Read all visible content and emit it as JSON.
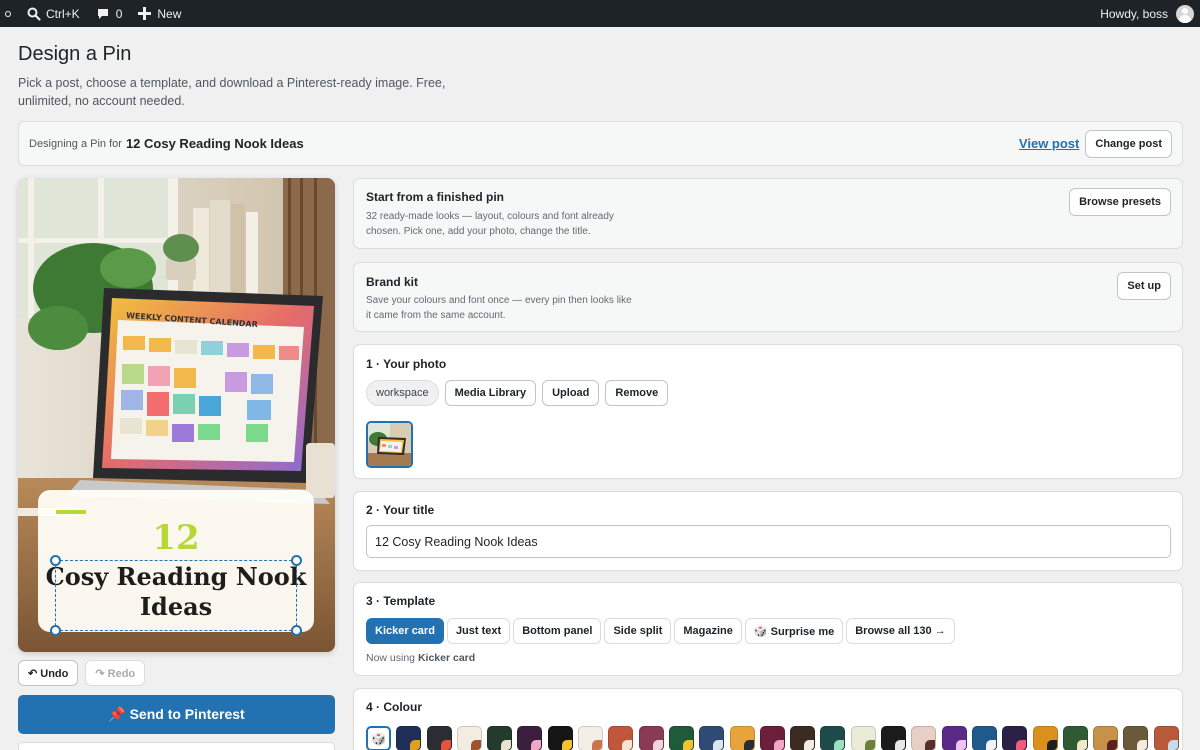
{
  "admin_bar": {
    "search_label": "Ctrl+K",
    "comments_count": "0",
    "new_label": "New",
    "greeting": "Howdy, boss"
  },
  "header": {
    "title": "Design a Pin",
    "description": "Pick a post, choose a template, and download a Pinterest-ready image. Free, unlimited, no account needed."
  },
  "context": {
    "prefix": "Designing a Pin for",
    "post_title": "12 Cosy Reading Nook Ideas",
    "view_post": "View post",
    "change_post": "Change post"
  },
  "preview": {
    "number": "12",
    "title": "Cosy Reading Nook Ideas",
    "photo_screen_text": "WEEKLY CONTENT CALENDAR",
    "undo_label": "↶ Undo",
    "redo_label": "↷ Redo",
    "send_label": "📌 Send to Pinterest"
  },
  "presets": {
    "title": "Start from a finished pin",
    "description": "32 ready-made looks — layout, colours and font already chosen. Pick one, add your photo, change the title.",
    "button": "Browse presets"
  },
  "brand_kit": {
    "title": "Brand kit",
    "description": "Save your colours and font once — every pin then looks like it came from the same account.",
    "button": "Set up"
  },
  "photo_section": {
    "title": "1 · Your photo",
    "tag": "workspace",
    "buttons": [
      "Media Library",
      "Upload",
      "Remove"
    ]
  },
  "title_section": {
    "title": "2 · Your title",
    "value": "12 Cosy Reading Nook Ideas"
  },
  "template_section": {
    "title": "3 · Template",
    "options": [
      "Kicker card",
      "Just text",
      "Bottom panel",
      "Side split",
      "Magazine",
      "🎲 Surprise me",
      "Browse all 130 →"
    ],
    "active": "Kicker card",
    "note_prefix": "Now using",
    "note_value": "Kicker card"
  },
  "colour_section": {
    "title": "4 · Colour",
    "dice_icon": "🎲",
    "swatches": [
      {
        "bg": "#1f2f5a",
        "accent": "#e0a21b"
      },
      {
        "bg": "#2a2d34",
        "accent": "#e5533b"
      },
      {
        "bg": "#f3ece0",
        "accent": "#a0522d"
      },
      {
        "bg": "#233a2c",
        "accent": "#e9e3d2"
      },
      {
        "bg": "#3b1f3e",
        "accent": "#f2a7c4"
      },
      {
        "bg": "#151515",
        "accent": "#f2c230"
      },
      {
        "bg": "#f4efe6",
        "accent": "#c9744a"
      },
      {
        "bg": "#c0563a",
        "accent": "#f5e6d3"
      },
      {
        "bg": "#8b3a55",
        "accent": "#f0d6dc"
      },
      {
        "bg": "#1f5a3a",
        "accent": "#f2c230"
      },
      {
        "bg": "#2f4a73",
        "accent": "#dce6f2"
      },
      {
        "bg": "#e6a43a",
        "accent": "#2a2d34"
      },
      {
        "bg": "#6b1f3a",
        "accent": "#f2a7c4"
      },
      {
        "bg": "#3b2b20",
        "accent": "#f3ece0"
      },
      {
        "bg": "#1f4a4a",
        "accent": "#9be0c4"
      },
      {
        "bg": "#ecebd9",
        "accent": "#6b7f3a"
      },
      {
        "bg": "#1b1b1b",
        "accent": "#e8e8e8"
      },
      {
        "bg": "#e8cfc6",
        "accent": "#5a2d2d"
      },
      {
        "bg": "#5b2a86",
        "accent": "#f0c4f2"
      },
      {
        "bg": "#1f5a8b",
        "accent": "#f2f2f2"
      },
      {
        "bg": "#2b2147",
        "accent": "#f25a7a"
      },
      {
        "bg": "#d9901f",
        "accent": "#1f1f1f"
      },
      {
        "bg": "#2f5a34",
        "accent": "#f0e6c8"
      },
      {
        "bg": "#c8914a",
        "accent": "#5a1f1f"
      },
      {
        "bg": "#6b5a3a",
        "accent": "#f3ece0"
      },
      {
        "bg": "#b85a3a",
        "accent": "#c4dcec"
      }
    ]
  }
}
